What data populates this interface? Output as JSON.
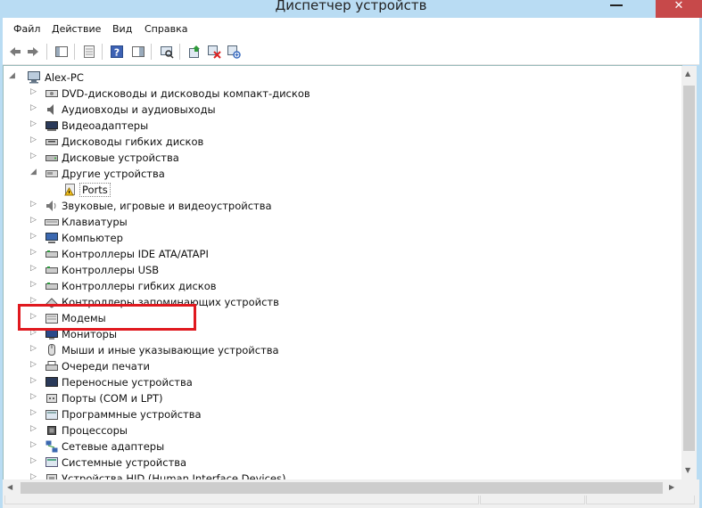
{
  "window": {
    "title": "Диспетчер устройств",
    "minimize_label": "",
    "close_label": "✕"
  },
  "menu": {
    "items": [
      "Файл",
      "Действие",
      "Вид",
      "Справка"
    ]
  },
  "toolbar": {
    "icons": [
      "back-arrow-icon",
      "forward-arrow-icon",
      "show-hide-console-tree-icon",
      "properties-icon",
      "help-icon",
      "action-pane-icon",
      "scan-hardware-icon",
      "update-driver-icon",
      "disable-device-icon",
      "uninstall-device-icon"
    ]
  },
  "tree": {
    "root": "Alex-PC",
    "items": [
      {
        "label": "DVD-дисководы и дисководы компакт-дисков",
        "icon": "dvd-drive-icon",
        "expanded": false
      },
      {
        "label": "Аудиовходы и аудиовыходы",
        "icon": "audio-io-icon",
        "expanded": false
      },
      {
        "label": "Видеоадаптеры",
        "icon": "display-adapter-icon",
        "expanded": false
      },
      {
        "label": "Дисководы гибких дисков",
        "icon": "floppy-drive-icon",
        "expanded": false
      },
      {
        "label": "Дисковые устройства",
        "icon": "disk-drive-icon",
        "expanded": false
      },
      {
        "label": "Другие устройства",
        "icon": "other-devices-icon",
        "expanded": true
      },
      {
        "label": "Ports",
        "icon": "warning-device-icon",
        "child": true
      },
      {
        "label": "Звуковые, игровые и видеоустройства",
        "icon": "sound-icon",
        "expanded": false
      },
      {
        "label": "Клавиатуры",
        "icon": "keyboard-icon",
        "expanded": false
      },
      {
        "label": "Компьютер",
        "icon": "computer-icon",
        "expanded": false
      },
      {
        "label": "Контроллеры IDE ATA/ATAPI",
        "icon": "ide-controller-icon",
        "expanded": false
      },
      {
        "label": "Контроллеры USB",
        "icon": "usb-controller-icon",
        "expanded": false
      },
      {
        "label": "Контроллеры гибких дисков",
        "icon": "floppy-controller-icon",
        "expanded": false
      },
      {
        "label": "Контроллеры запоминающих устройств",
        "icon": "storage-controller-icon",
        "expanded": false
      },
      {
        "label": "Модемы",
        "icon": "modem-icon",
        "expanded": false
      },
      {
        "label": "Мониторы",
        "icon": "monitor-icon",
        "expanded": false
      },
      {
        "label": "Мыши и иные указывающие устройства",
        "icon": "mouse-icon",
        "expanded": false
      },
      {
        "label": "Очереди печати",
        "icon": "printer-icon",
        "expanded": false
      },
      {
        "label": "Переносные устройства",
        "icon": "portable-device-icon",
        "expanded": false
      },
      {
        "label": "Порты (COM и LPT)",
        "icon": "port-icon",
        "expanded": false
      },
      {
        "label": "Программные устройства",
        "icon": "software-device-icon",
        "expanded": false
      },
      {
        "label": "Процессоры",
        "icon": "processor-icon",
        "expanded": false
      },
      {
        "label": "Сетевые адаптеры",
        "icon": "network-adapter-icon",
        "expanded": false
      },
      {
        "label": "Системные устройства",
        "icon": "system-device-icon",
        "expanded": false
      },
      {
        "label": "Устройства HID (Human Interface Devices)",
        "icon": "hid-icon",
        "expanded": false
      }
    ]
  },
  "annotation": {
    "highlight_color": "#e0191f"
  }
}
